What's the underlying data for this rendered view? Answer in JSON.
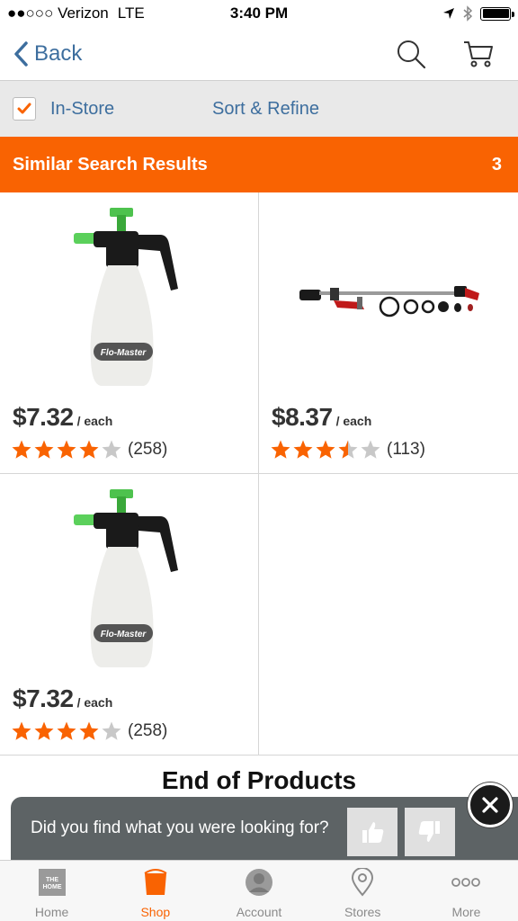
{
  "status_bar": {
    "carrier": "●●○○○ Verizon",
    "network": "LTE",
    "time": "3:40 PM"
  },
  "nav": {
    "back_label": "Back",
    "icons": [
      "search-icon",
      "cart-icon"
    ]
  },
  "filter": {
    "in_store_label": "In-Store",
    "in_store_checked": true,
    "sort_refine_label": "Sort & Refine"
  },
  "results": {
    "title": "Similar Search Results",
    "count": "3"
  },
  "products": [
    {
      "price": "$7.32",
      "unit": "/ each",
      "rating": 4,
      "reviews": "(258)"
    },
    {
      "price": "$8.37",
      "unit": "/ each",
      "rating": 3.5,
      "reviews": "(113)"
    },
    {
      "price": "$7.32",
      "unit": "/ each",
      "rating": 4,
      "reviews": "(258)"
    }
  ],
  "end_of_products": "End of Products",
  "feedback": {
    "question": "Did you find what you were looking for?"
  },
  "tabs": [
    {
      "label": "Home",
      "icon": "home-depot-logo-icon",
      "active": false
    },
    {
      "label": "Shop",
      "icon": "bucket-icon",
      "active": true
    },
    {
      "label": "Account",
      "icon": "account-icon",
      "active": false
    },
    {
      "label": "Stores",
      "icon": "location-pin-icon",
      "active": false
    },
    {
      "label": "More",
      "icon": "more-dots-icon",
      "active": false
    }
  ],
  "colors": {
    "accent": "#f96302",
    "link": "#3d6e9e",
    "star_empty": "#c8c8c8"
  }
}
